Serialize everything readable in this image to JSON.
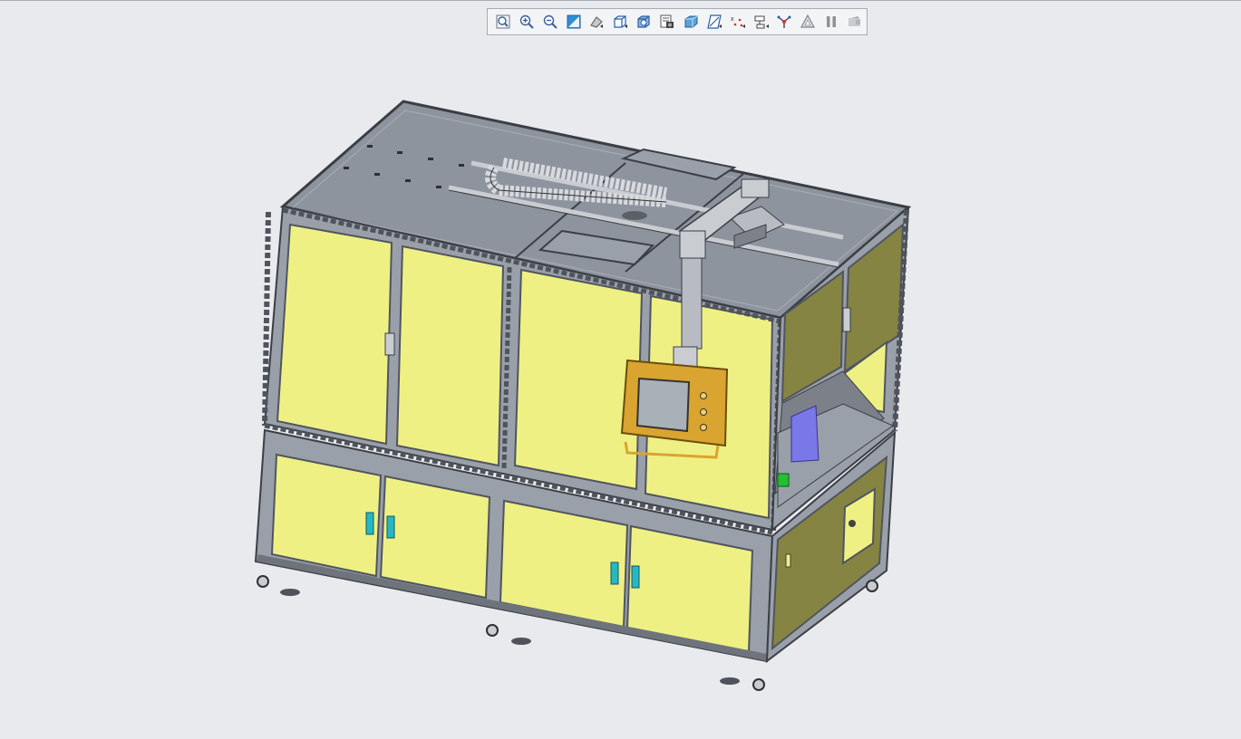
{
  "toolbar": {
    "buttons": [
      {
        "name": "zoom-fit-icon"
      },
      {
        "name": "zoom-in-icon"
      },
      {
        "name": "zoom-out-icon"
      },
      {
        "name": "repaint-icon"
      },
      {
        "name": "view-orient-icon"
      },
      {
        "name": "named-views-icon"
      },
      {
        "name": "display-style-icon"
      },
      {
        "name": "view-manager-icon"
      },
      {
        "name": "perspective-icon"
      },
      {
        "name": "datum-display-icon"
      },
      {
        "name": "datum-points-icon"
      },
      {
        "name": "annotation-display-icon"
      },
      {
        "name": "spin-center-icon"
      },
      {
        "name": "regenerate-icon"
      },
      {
        "name": "pause-icon"
      },
      {
        "name": "animation-icon"
      }
    ]
  },
  "model": {
    "colors": {
      "background": "#e8eaee",
      "frame": "#9aa0a9",
      "frame_dark": "#4f545c",
      "panel": "#eff084",
      "panel_shade": "#858443",
      "top_plate": "#8e949e",
      "hmi_housing": "#d9a42f",
      "hmi_screen": "#a9b1b8",
      "blue_bracket": "#7a78e8",
      "handle": "#27b7c4",
      "green_part": "#22c033"
    }
  }
}
